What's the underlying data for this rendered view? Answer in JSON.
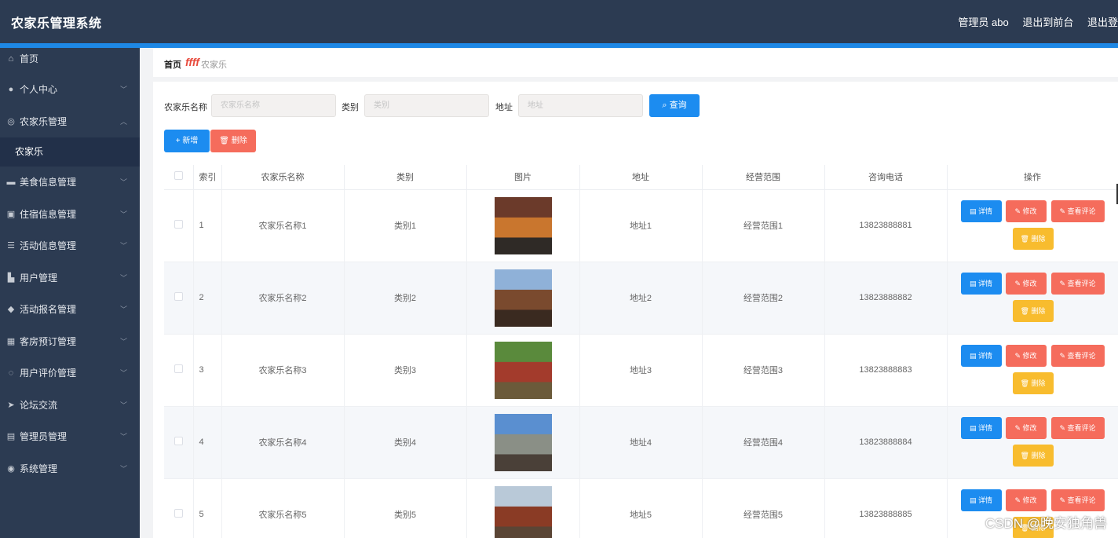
{
  "header": {
    "title": "农家乐管理系统",
    "user": "管理员 abo",
    "front": "退出到前台",
    "logout": "退出登"
  },
  "sidebar": {
    "items": [
      {
        "label": "首页",
        "icon": "home-icon",
        "glyph": "⌂"
      },
      {
        "label": "个人中心",
        "icon": "user-icon",
        "glyph": "●"
      },
      {
        "label": "农家乐管理",
        "icon": "globe-icon",
        "glyph": "◎"
      },
      {
        "label": "美食信息管理",
        "icon": "chat-icon",
        "glyph": "▬"
      },
      {
        "label": "住宿信息管理",
        "icon": "image-icon",
        "glyph": "▣"
      },
      {
        "label": "活动信息管理",
        "icon": "filter-icon",
        "glyph": "☰"
      },
      {
        "label": "用户管理",
        "icon": "bank-icon",
        "glyph": "▙"
      },
      {
        "label": "活动报名管理",
        "icon": "location-icon",
        "glyph": "◆"
      },
      {
        "label": "客房预订管理",
        "icon": "grid-icon",
        "glyph": "▦"
      },
      {
        "label": "用户评价管理",
        "icon": "power-icon",
        "glyph": "◌"
      },
      {
        "label": "论坛交流",
        "icon": "send-icon",
        "glyph": "➤"
      },
      {
        "label": "管理员管理",
        "icon": "briefcase-icon",
        "glyph": "▤"
      },
      {
        "label": "系统管理",
        "icon": "compass-icon",
        "glyph": "◉"
      }
    ],
    "sub_item": "农家乐"
  },
  "breadcrumb": {
    "home": "首页",
    "separator": "ffff",
    "current": "农家乐"
  },
  "search": {
    "name_label": "农家乐名称",
    "name_placeholder": "农家乐名称",
    "type_label": "类别",
    "type_placeholder": "类别",
    "addr_label": "地址",
    "addr_placeholder": "地址",
    "query": "查询"
  },
  "actions": {
    "add": "新增",
    "delete": "删除"
  },
  "table": {
    "headers": [
      "索引",
      "农家乐名称",
      "类别",
      "图片",
      "地址",
      "经营范围",
      "咨询电话",
      "操作"
    ],
    "rows": [
      {
        "index": "1",
        "name": "农家乐名称1",
        "type": "类别1",
        "address": "地址1",
        "scope": "经营范围1",
        "phone": "13823888881"
      },
      {
        "index": "2",
        "name": "农家乐名称2",
        "type": "类别2",
        "address": "地址2",
        "scope": "经营范围2",
        "phone": "13823888882"
      },
      {
        "index": "3",
        "name": "农家乐名称3",
        "type": "类别3",
        "address": "地址3",
        "scope": "经营范围3",
        "phone": "13823888883"
      },
      {
        "index": "4",
        "name": "农家乐名称4",
        "type": "类别4",
        "address": "地址4",
        "scope": "经营范围4",
        "phone": "13823888884"
      },
      {
        "index": "5",
        "name": "农家乐名称5",
        "type": "类别5",
        "address": "地址5",
        "scope": "经营范围5",
        "phone": "13823888885"
      }
    ],
    "op_detail": "详情",
    "op_edit": "修改",
    "op_review": "查看评论",
    "op_delete": "删除"
  },
  "watermark": "CSDN @晚安独角兽",
  "colors": {
    "header_bg": "#2c3b52",
    "accent_blue": "#1c8cf0",
    "danger_red": "#f56c5c",
    "warning_yellow": "#f8bc2e"
  }
}
